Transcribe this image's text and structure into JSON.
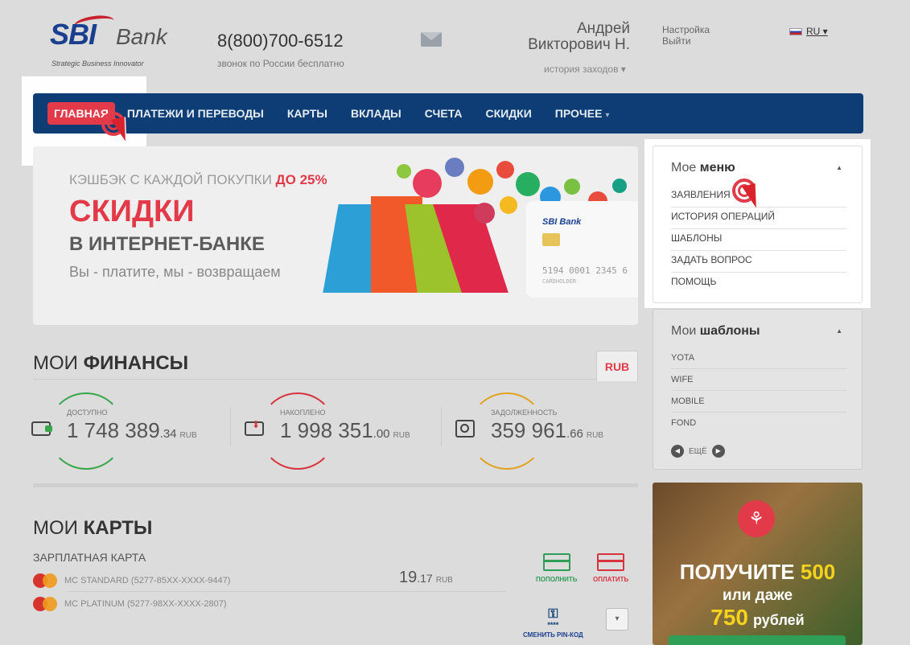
{
  "brand": {
    "logo_main": "SBI",
    "logo_sub": "Bank",
    "tagline": "Strategic Business Innovator"
  },
  "header": {
    "phone": "8(800)700-6512",
    "phone_note": "звонок по России бесплатно",
    "user_first": "Андрей",
    "user_last": "Викторович Н.",
    "history_link": "история заходов ▾",
    "settings_link": "Настройка",
    "logout_link": "Выйти",
    "language": "RU ▾"
  },
  "nav": {
    "items": [
      {
        "label": "ГЛАВНАЯ"
      },
      {
        "label": "ПЛАТЕЖИ И ПЕРЕВОДЫ"
      },
      {
        "label": "КАРТЫ"
      },
      {
        "label": "ВКЛАДЫ"
      },
      {
        "label": "СЧЕТА"
      },
      {
        "label": "СКИДКИ"
      },
      {
        "label": "ПРОЧЕЕ"
      }
    ]
  },
  "banner": {
    "line1_prefix": "КЭШБЭК С КАЖДОЙ ПОКУПКИ",
    "line1_highlight": "ДО 25%",
    "line2": "СКИДКИ",
    "line3": "В ИНТЕРНЕТ-БАНКЕ",
    "line4": "Вы - платите, мы - возвращаем",
    "card_number": "5194 0001 2345 6",
    "card_holder": "CARDHOLDER",
    "card_logo": "SBI Bank"
  },
  "finances": {
    "title_prefix": "МОИ",
    "title_bold": "ФИНАНСЫ",
    "currency_tab": "RUB",
    "stats": [
      {
        "label": "ДОСТУПНО",
        "value": "1 748 389",
        "decimals": ".34",
        "currency": "RUB",
        "color": "#3aa64c"
      },
      {
        "label": "НАКОПЛЕНО",
        "value": "1 998 351",
        "decimals": ".00",
        "currency": "RUB",
        "color": "#d8343f"
      },
      {
        "label": "ЗАДОЛЖЕННОСТЬ",
        "value": "359 961",
        "decimals": ".66",
        "currency": "RUB",
        "color": "#e2a31e"
      }
    ]
  },
  "cards": {
    "title_prefix": "МОИ",
    "title_bold": "КАРТЫ",
    "group": "ЗАРПЛАТНАЯ КАРТА",
    "rows": [
      {
        "name": "MC STANDARD (5277-85XX-XXXX-9447)"
      },
      {
        "name": "MC PLATINUM (5277-98XX-XXXX-2807)"
      }
    ],
    "amount": "19",
    "amount_decimals": ".17",
    "amount_currency": "RUB",
    "action_topup": "ПОПОЛНИТЬ",
    "action_pay": "ОПЛАТИТЬ",
    "action_pin": "СМЕНИТЬ PIN-КОД"
  },
  "my_menu": {
    "title_prefix": "Мое",
    "title_bold": "меню",
    "items": [
      "ЗАЯВЛЕНИЯ",
      "ИСТОРИЯ ОПЕРАЦИЙ",
      "ШАБЛОНЫ",
      "ЗАДАТЬ ВОПРОС",
      "ПОМОЩЬ"
    ]
  },
  "my_templates": {
    "title_prefix": "Мои",
    "title_bold": "шаблоны",
    "items": [
      "YOTA",
      "WIFE",
      "MOBILE",
      "FOND"
    ],
    "more": "ЕЩЁ"
  },
  "promo": {
    "line1_prefix": "ПОЛУЧИТЕ",
    "line1_num": "500",
    "line2": "или даже",
    "line3_num": "750",
    "line3_suffix": "рублей"
  },
  "colors": {
    "nav_bg": "#0d3d74",
    "accent": "#e23a48",
    "brand_blue": "#1a3f8f"
  }
}
